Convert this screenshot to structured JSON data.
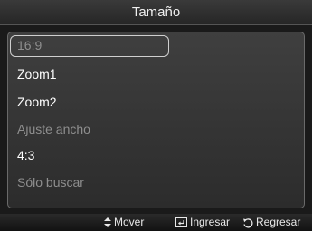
{
  "header": {
    "title": "Tamaño"
  },
  "menu": {
    "items": [
      {
        "label": "16:9",
        "state": "selected-disabled"
      },
      {
        "label": "Zoom1",
        "state": "enabled"
      },
      {
        "label": "Zoom2",
        "state": "enabled"
      },
      {
        "label": "Ajuste ancho",
        "state": "disabled"
      },
      {
        "label": "4:3",
        "state": "enabled"
      },
      {
        "label": "Sólo buscar",
        "state": "disabled"
      }
    ]
  },
  "footer": {
    "move": {
      "icon": "up-down-arrows-icon",
      "label": "Mover"
    },
    "enter": {
      "icon": "enter-icon",
      "label": "Ingresar"
    },
    "back": {
      "icon": "return-icon",
      "label": "Regresar"
    }
  },
  "colors": {
    "background": "#1a1a1a",
    "panel": "#363636",
    "text_enabled": "#ffffff",
    "text_disabled": "#8e8e8e",
    "selection_border": "#cfcfcf"
  }
}
